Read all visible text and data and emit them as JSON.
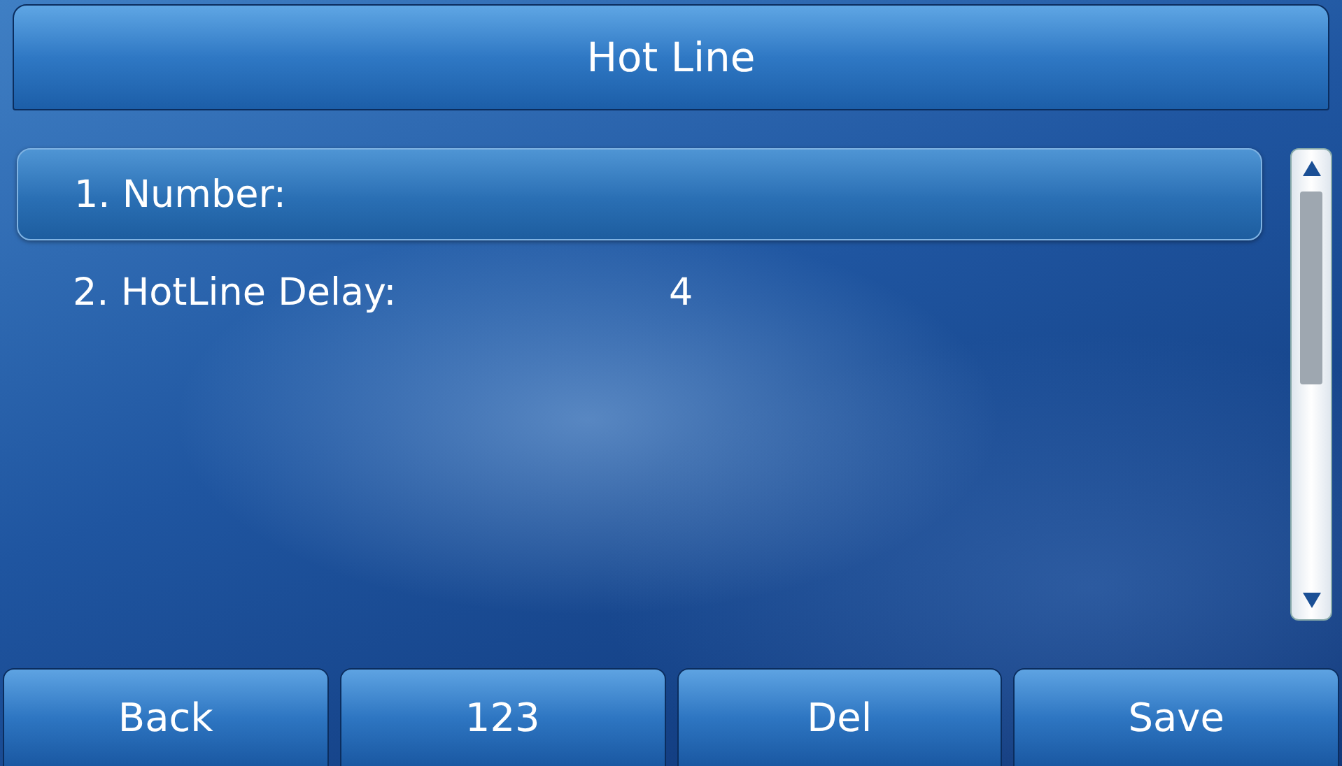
{
  "title": "Hot Line",
  "items": [
    {
      "label": "1. Number:",
      "selected": true
    },
    {
      "label": "2. HotLine Delay:",
      "value": "4",
      "selected": false
    }
  ],
  "softkeys": [
    "Back",
    "123",
    "Del",
    "Save"
  ]
}
